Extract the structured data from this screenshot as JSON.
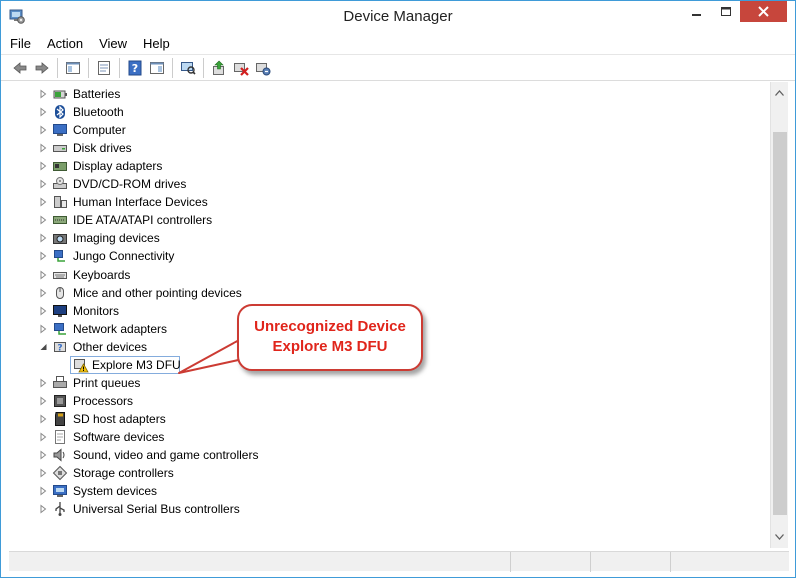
{
  "window": {
    "title": "Device Manager"
  },
  "menu": [
    "File",
    "Action",
    "View",
    "Help"
  ],
  "toolbar": {
    "icons": [
      "back-arrow-icon",
      "forward-arrow-icon",
      "show-hide-console-tree-icon",
      "properties-icon",
      "help-icon",
      "action-pane-icon",
      "scan-hardware-changes-icon",
      "update-driver-icon",
      "uninstall-device-icon",
      "enable-device-icon"
    ]
  },
  "tree": {
    "categories": [
      {
        "label": "Batteries",
        "icon": "battery-icon",
        "expanded": false
      },
      {
        "label": "Bluetooth",
        "icon": "bluetooth-icon",
        "expanded": false
      },
      {
        "label": "Computer",
        "icon": "computer-icon",
        "expanded": false
      },
      {
        "label": "Disk drives",
        "icon": "disk-drive-icon",
        "expanded": false
      },
      {
        "label": "Display adapters",
        "icon": "display-adapter-icon",
        "expanded": false
      },
      {
        "label": "DVD/CD-ROM drives",
        "icon": "dvd-drive-icon",
        "expanded": false
      },
      {
        "label": "Human Interface Devices",
        "icon": "hid-icon",
        "expanded": false
      },
      {
        "label": "IDE ATA/ATAPI controllers",
        "icon": "ide-controller-icon",
        "expanded": false
      },
      {
        "label": "Imaging devices",
        "icon": "camera-icon",
        "expanded": false
      },
      {
        "label": "Jungo Connectivity",
        "icon": "network-icon",
        "expanded": false
      },
      {
        "label": "Keyboards",
        "icon": "keyboard-icon",
        "expanded": false
      },
      {
        "label": "Mice and other pointing devices",
        "icon": "mouse-icon",
        "expanded": false
      },
      {
        "label": "Monitors",
        "icon": "monitor-icon",
        "expanded": false
      },
      {
        "label": "Network adapters",
        "icon": "network-adapter-icon",
        "expanded": false
      },
      {
        "label": "Other devices",
        "icon": "other-devices-icon",
        "expanded": true
      },
      {
        "label": "Print queues",
        "icon": "printer-icon",
        "expanded": false
      },
      {
        "label": "Processors",
        "icon": "processor-icon",
        "expanded": false
      },
      {
        "label": "SD host adapters",
        "icon": "sd-card-icon",
        "expanded": false
      },
      {
        "label": "Software devices",
        "icon": "software-device-icon",
        "expanded": false
      },
      {
        "label": "Sound, video and game controllers",
        "icon": "speaker-icon",
        "expanded": false
      },
      {
        "label": "Storage controllers",
        "icon": "storage-controller-icon",
        "expanded": false
      },
      {
        "label": "System devices",
        "icon": "system-device-icon",
        "expanded": false
      },
      {
        "label": "Universal Serial Bus controllers",
        "icon": "usb-icon",
        "expanded": false
      }
    ],
    "child_of_other_devices": {
      "label": "Explore M3 DFU",
      "icon": "warning-device-icon"
    }
  },
  "callout": {
    "line1": "Unrecognized Device",
    "line2": "Explore M3 DFU"
  },
  "colors": {
    "accent_border": "#3f9bd8",
    "close_button": "#c7463c",
    "callout_text": "#e0251b",
    "callout_border": "#cc3b33",
    "selection_border": "#84acdd"
  }
}
